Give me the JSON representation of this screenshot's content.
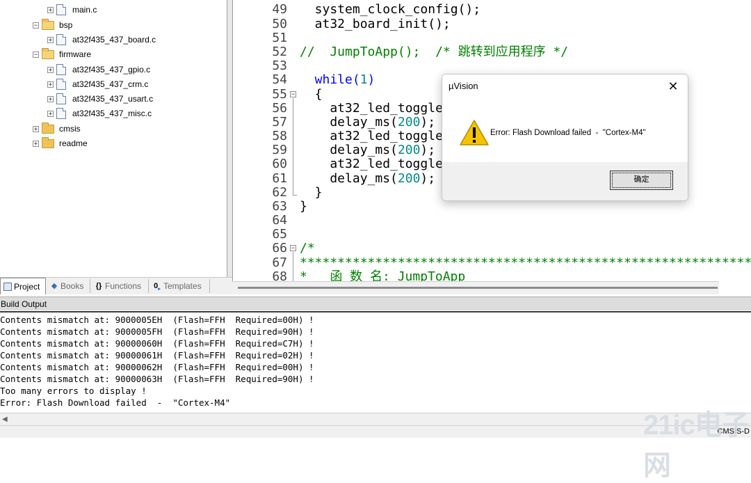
{
  "project_tree": {
    "items": [
      {
        "type": "file",
        "label": "main.c"
      },
      {
        "type": "folder-open",
        "label": "bsp"
      },
      {
        "type": "file",
        "label": "at32f435_437_board.c"
      },
      {
        "type": "folder-open",
        "label": "firmware"
      },
      {
        "type": "file",
        "label": "at32f435_437_gpio.c"
      },
      {
        "type": "file",
        "label": "at32f435_437_crm.c"
      },
      {
        "type": "file",
        "label": "at32f435_437_usart.c"
      },
      {
        "type": "file",
        "label": "at32f435_437_misc.c"
      },
      {
        "type": "folder",
        "label": "cmsis"
      },
      {
        "type": "folder",
        "label": "readme"
      }
    ],
    "tabs": [
      {
        "label": "Project",
        "icon": "project-icon",
        "active": true
      },
      {
        "label": "Books",
        "icon": "books-icon",
        "active": false
      },
      {
        "label": "Functions",
        "icon": "functions-icon",
        "active": false
      },
      {
        "label": "Templates",
        "icon": "templates-icon",
        "active": false
      }
    ]
  },
  "editor": {
    "lines": [
      {
        "num": "49",
        "code": "  system_clock_config();"
      },
      {
        "num": "50",
        "code": "  at32_board_init();"
      },
      {
        "num": "51",
        "code": ""
      },
      {
        "num": "52",
        "code": "//  JumpToApp();  /* 跳转到应用程序 */"
      },
      {
        "num": "53",
        "code": ""
      },
      {
        "num": "54",
        "code": "  while(1)"
      },
      {
        "num": "55",
        "code": "  {"
      },
      {
        "num": "56",
        "code": "    at32_led_toggle"
      },
      {
        "num": "57",
        "code": "    delay_ms(200);"
      },
      {
        "num": "58",
        "code": "    at32_led_toggle"
      },
      {
        "num": "59",
        "code": "    delay_ms(200);"
      },
      {
        "num": "60",
        "code": "    at32_led_toggle"
      },
      {
        "num": "61",
        "code": "    delay_ms(200);"
      },
      {
        "num": "62",
        "code": "  }"
      },
      {
        "num": "63",
        "code": "}"
      },
      {
        "num": "64",
        "code": ""
      },
      {
        "num": "65",
        "code": ""
      },
      {
        "num": "66",
        "code": "/*"
      },
      {
        "num": "67",
        "code": "*****************************************************************"
      },
      {
        "num": "68",
        "code": "*   函 数 名: JumpToApp"
      }
    ]
  },
  "build_output": {
    "title": "Build Output",
    "lines": [
      "Contents mismatch at: 9000005EH  (Flash=FFH  Required=00H) !",
      "Contents mismatch at: 9000005FH  (Flash=FFH  Required=90H) !",
      "Contents mismatch at: 90000060H  (Flash=FFH  Required=C7H) !",
      "Contents mismatch at: 90000061H  (Flash=FFH  Required=02H) !",
      "Contents mismatch at: 90000062H  (Flash=FFH  Required=00H) !",
      "Contents mismatch at: 90000063H  (Flash=FFH  Required=90H) !",
      "Too many errors to display !",
      "Error: Flash Download failed  -  \"Cortex-M4\""
    ]
  },
  "status_bar": {
    "text": "CMSIS-D"
  },
  "watermark": {
    "text": "21ic电子网"
  },
  "dialog": {
    "title": "µVision",
    "message": "Error: Flash Download failed  -  \"Cortex-M4\"",
    "ok_label": "确定",
    "icon": "warning-icon",
    "close_icon": "close-icon"
  },
  "colors": {
    "keyword": "#0000ff",
    "number": "#008b8b",
    "comment": "#008000",
    "warning": "#f5c400"
  }
}
